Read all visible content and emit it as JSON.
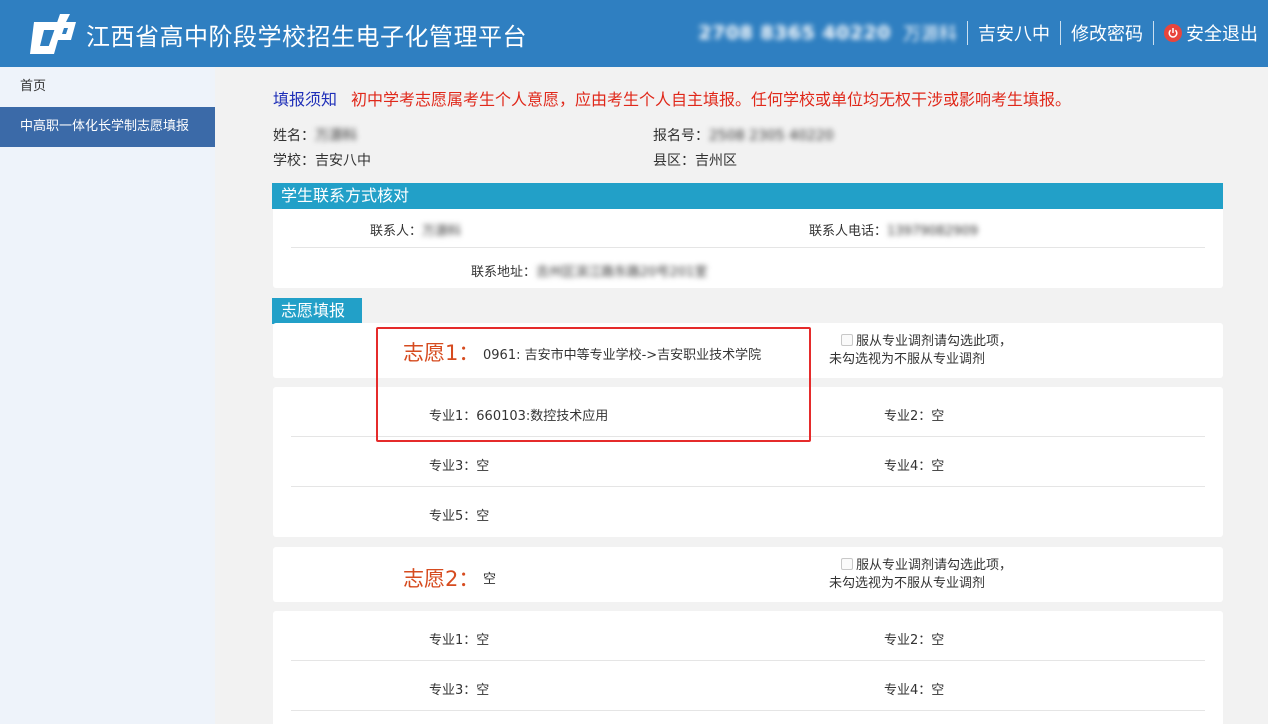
{
  "header": {
    "app_title": "江西省高中阶段学校招生电子化管理平台",
    "account_id": "2708 8365 40220",
    "user_name": "万源科",
    "school": "吉安八中",
    "change_password": "修改密码",
    "logout": "安全退出"
  },
  "sidebar": {
    "items": [
      {
        "label": "首页"
      },
      {
        "label": "中高职一体化长学制志愿填报"
      }
    ]
  },
  "notice": {
    "title": "填报须知",
    "text": "初中学考志愿属考生个人意愿，应由考生个人自主填报。任何学校或单位均无权干涉或影响考生填报。"
  },
  "student": {
    "name_label": "姓名：",
    "name_value": "万源科",
    "regno_label": "报名号：",
    "regno_value": "2508 2305 40220",
    "school_label": "学校：",
    "school_value": "吉安八中",
    "county_label": "县区：",
    "county_value": "吉州区"
  },
  "contact": {
    "heading": "学生联系方式核对",
    "person_label": "联系人：",
    "person_value": "万源科",
    "phone_label": "联系人电话：",
    "phone_value": "13979082909",
    "address_label": "联系地址：",
    "address_value": "吉州区滨江路东路20号201室"
  },
  "volunteer_section": {
    "heading": "志愿填报"
  },
  "volunteers": [
    {
      "label": "志愿1：",
      "school": "0961: 吉安市中等专业学校->吉安职业技术学院",
      "adjust_line1": "服从专业调剂请勾选此项，",
      "adjust_line2": "未勾选视为不服从专业调剂",
      "majors": [
        {
          "label": "专业1：",
          "value": "660103:数控技术应用"
        },
        {
          "label": "专业2：",
          "value": "空"
        },
        {
          "label": "专业3：",
          "value": "空"
        },
        {
          "label": "专业4：",
          "value": "空"
        },
        {
          "label": "专业5：",
          "value": "空"
        }
      ]
    },
    {
      "label": "志愿2：",
      "school": "空",
      "adjust_line1": "服从专业调剂请勾选此项，",
      "adjust_line2": "未勾选视为不服从专业调剂",
      "majors": [
        {
          "label": "专业1：",
          "value": "空"
        },
        {
          "label": "专业2：",
          "value": "空"
        },
        {
          "label": "专业3：",
          "value": "空"
        },
        {
          "label": "专业4：",
          "value": "空"
        }
      ]
    }
  ],
  "colors": {
    "header_bg": "#2f7fc1",
    "sidebar_active": "#3b6aa8",
    "panel_head": "#22a0c8",
    "notice_red": "#e0281a",
    "volunteer_label": "#d64b1f",
    "highlight_box": "#e52b2b"
  }
}
